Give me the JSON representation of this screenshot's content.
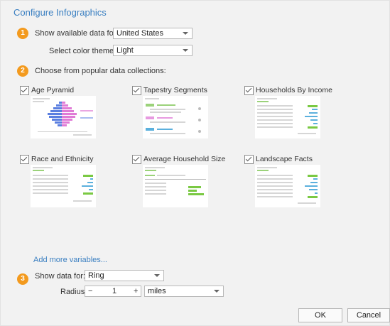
{
  "dialog": {
    "title": "Configure Infographics"
  },
  "steps": [
    "1",
    "2",
    "3"
  ],
  "section1": {
    "data_for_label": "Show available data for:",
    "data_for_value": "United States",
    "theme_label": "Select color theme:",
    "theme_value": "Light"
  },
  "section2": {
    "label": "Choose from popular data collections:",
    "collections": [
      {
        "name": "Age Pyramid",
        "checked": true
      },
      {
        "name": "Tapestry Segments",
        "checked": true
      },
      {
        "name": "Households By Income",
        "checked": true
      },
      {
        "name": "Race and Ethnicity",
        "checked": true
      },
      {
        "name": "Average Household Size",
        "checked": true
      },
      {
        "name": "Landscape Facts",
        "checked": true
      }
    ],
    "add_more_link": "Add more variables..."
  },
  "section3": {
    "show_for_label": "Show data for:",
    "show_for_value": "Ring",
    "radius_label": "Radius:",
    "radius_minus": "−",
    "radius_value": "1",
    "radius_plus": "+",
    "units_value": "miles"
  },
  "buttons": {
    "ok": "OK",
    "cancel": "Cancel"
  },
  "colors": {
    "accent": "#3a7fc1",
    "step_badge": "#f39a1e"
  }
}
